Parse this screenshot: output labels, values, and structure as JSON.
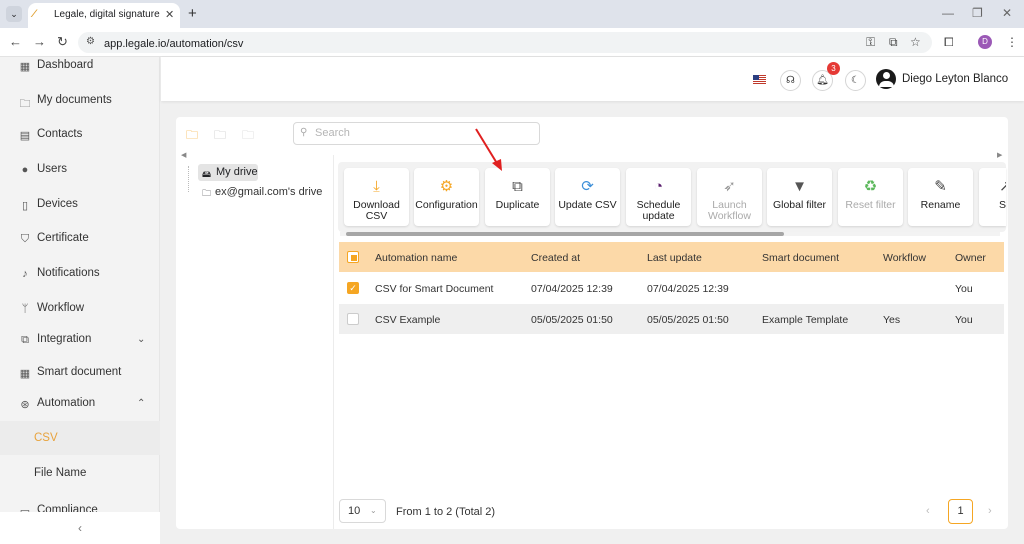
{
  "browser": {
    "tab_title": "Legale, digital signature",
    "url": "app.legale.io/automation/csv",
    "profile_initial": "D"
  },
  "sidebar": {
    "items": [
      {
        "label": "Dashboard",
        "icon": "dashboard-icon"
      },
      {
        "label": "My documents",
        "icon": "folder-icon"
      },
      {
        "label": "Contacts",
        "icon": "contacts-icon"
      },
      {
        "label": "Users",
        "icon": "user-icon"
      },
      {
        "label": "Devices",
        "icon": "device-icon"
      },
      {
        "label": "Certificate",
        "icon": "shield-icon"
      },
      {
        "label": "Notifications",
        "icon": "bell-icon"
      },
      {
        "label": "Workflow",
        "icon": "workflow-icon"
      },
      {
        "label": "Integration",
        "icon": "integration-icon"
      },
      {
        "label": "Smart document",
        "icon": "smart-document-icon"
      },
      {
        "label": "Automation",
        "icon": "automation-icon"
      },
      {
        "label": "CSV"
      },
      {
        "label": "File Name"
      },
      {
        "label": "Compliance",
        "icon": "compliance-icon"
      }
    ],
    "active": "CSV",
    "collapse_glyph": "‹"
  },
  "header": {
    "notification_count": "3",
    "user_name": "Diego Leyton Blanco"
  },
  "search": {
    "placeholder": "Search"
  },
  "tree": {
    "items": [
      {
        "label": "My drive"
      },
      {
        "label": "ex@gmail.com's drive"
      }
    ]
  },
  "toolbar": {
    "buttons": [
      {
        "label": "Download CSV",
        "icon": "download-icon",
        "enabled": true
      },
      {
        "label": "Configuration",
        "icon": "gear-icon",
        "enabled": true
      },
      {
        "label": "Duplicate",
        "icon": "copy-icon",
        "enabled": true
      },
      {
        "label": "Update CSV",
        "icon": "sync-icon",
        "enabled": true
      },
      {
        "label": "Schedule update",
        "icon": "schedule-icon",
        "enabled": true
      },
      {
        "label": "Launch Workflow",
        "icon": "rocket-icon",
        "enabled": false
      },
      {
        "label": "Global filter",
        "icon": "filter-icon",
        "enabled": true
      },
      {
        "label": "Reset filter",
        "icon": "recycle-icon",
        "enabled": false
      },
      {
        "label": "Rename",
        "icon": "pencil-icon",
        "enabled": true
      },
      {
        "label": "S",
        "icon": "share-icon",
        "enabled": true
      }
    ]
  },
  "table": {
    "columns": [
      "Automation name",
      "Created at",
      "Last update",
      "Smart document",
      "Workflow",
      "Owner"
    ],
    "rows": [
      {
        "checked": true,
        "cells": [
          "CSV for Smart Document",
          "07/04/2025 12:39",
          "07/04/2025 12:39",
          "",
          "",
          "You"
        ]
      },
      {
        "checked": false,
        "cells": [
          "CSV Example",
          "05/05/2025 01:50",
          "05/05/2025 01:50",
          "Example Template",
          "Yes",
          "You"
        ]
      }
    ]
  },
  "footer": {
    "page_size": "10",
    "total_text": "From 1 to 2 (Total 2)",
    "current_page": "1"
  },
  "colors": {
    "accent": "#f5a623",
    "table_header_bg": "#fcd9a8",
    "annotation_arrow": "#e02020"
  }
}
